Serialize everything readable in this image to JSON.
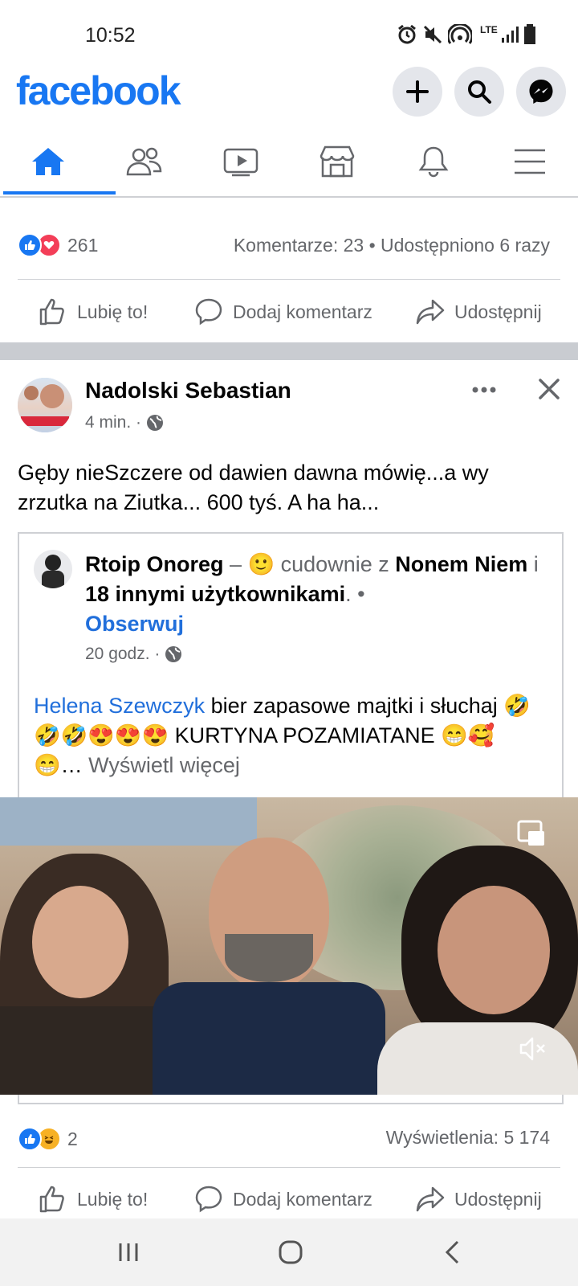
{
  "status": {
    "time": "10:52",
    "network": "LTE"
  },
  "header": {
    "logo": "facebook"
  },
  "nav": {
    "items": [
      "home-icon",
      "friends-icon",
      "watch-icon",
      "marketplace-icon",
      "notifications-icon",
      "menu-icon"
    ]
  },
  "prev_post": {
    "reaction_count": "261",
    "stats": "Komentarze: 23 • Udostępniono 6 razy",
    "actions": {
      "like": "Lubię to!",
      "comment": "Dodaj komentarz",
      "share": "Udostępnij"
    }
  },
  "post": {
    "author": "Nadolski Sebastian",
    "time": "4 min. ·",
    "text": "Gęby nieSzczere od dawien dawna mówię...a wy zrzutka na Ziutka... 600 tyś. A ha ha...",
    "shared": {
      "author": "Rtoip Onoreg",
      "dash": " – ",
      "feeling_emoji": "🙂",
      "feeling": " cudownie z ",
      "with1": "Nonem Niem",
      "and": " i ",
      "with2": "18 innymi użytkownikami",
      "dot": ".  •",
      "follow": "Obserwuj",
      "time": "20 godz. ·",
      "mention": "Helena Szewczyk",
      "text1": " bier zapasowe majtki i słuchaj ",
      "emojis1": "🤣🤣🤣😍😍😍",
      "text2": " KURTYNA POZAMIATANE ",
      "emojis2": "😁🥰😁",
      "ellipsis": "… ",
      "see_more": "Wyświetl więcej"
    },
    "reaction_count": "2",
    "views": "Wyświetlenia: 5 174",
    "actions": {
      "like": "Lubię to!",
      "comment": "Dodaj komentarz",
      "share": "Udostępnij"
    }
  },
  "colors": {
    "brand": "#1877f2",
    "text": "#050505",
    "secondary": "#65676b",
    "divider": "#ced0d4"
  }
}
